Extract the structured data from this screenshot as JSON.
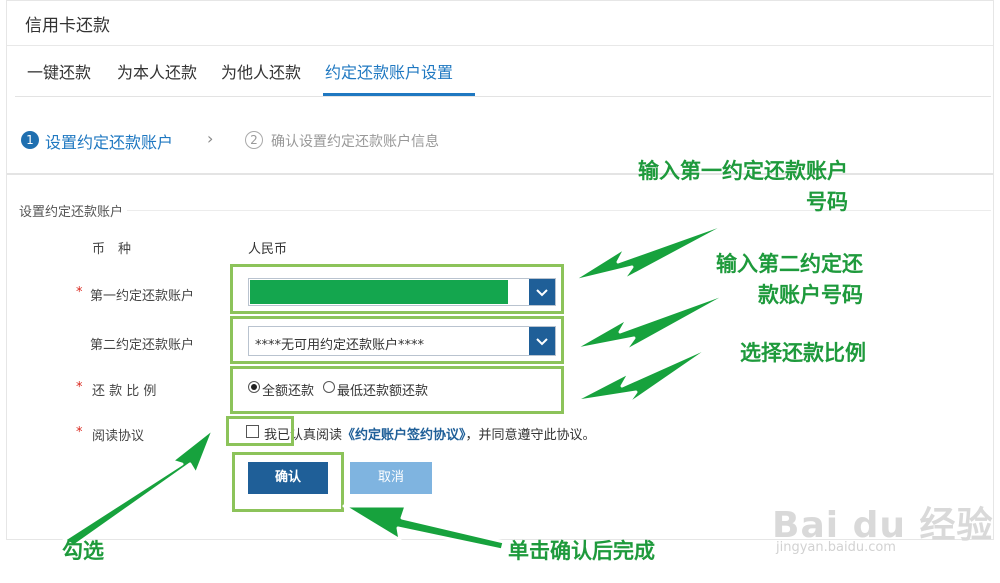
{
  "title": "信用卡还款",
  "tabs": [
    {
      "label": "一键还款"
    },
    {
      "label": "为本人还款"
    },
    {
      "label": "为他人还款"
    },
    {
      "label": "约定还款账户设置"
    }
  ],
  "steps": {
    "step1_num": "1",
    "step1_label": "设置约定还款账户",
    "chevron": "›",
    "step2_num": "2",
    "step2_label": "确认设置约定还款账户信息"
  },
  "section_title": "设置约定还款账户",
  "form": {
    "required_mark": "*",
    "currency_label": "币　种",
    "currency_value": "人民币",
    "account1_label": "第一约定还款账户",
    "account2_label": "第二约定还款账户",
    "account2_value": "****无可用约定还款账户****",
    "ratio_label": "还 款 比 例",
    "ratio_options": [
      {
        "label": "全额还款",
        "checked": true
      },
      {
        "label": "最低还款额还款",
        "checked": false
      }
    ],
    "agreement_label": "阅读协议",
    "agree_prefix": "我已认真阅读",
    "agree_link": "《约定账户签约协议》",
    "agree_suffix": "，并同意遵守此协议。",
    "dropdown_arrow": "⌄"
  },
  "buttons": {
    "confirm": "确认",
    "cancel": "取消"
  },
  "annotations": {
    "note1_line1": "输入第一约定还款账户",
    "note1_line2": "号码",
    "note2_line1": "输入第二约定还",
    "note2_line2": "款账户号码",
    "note3": "选择还款比例",
    "note4": "勾选",
    "note5": "单击确认后完成"
  },
  "colors": {
    "accent": "#1f78c1",
    "button_primary": "#1f5f98",
    "button_secondary": "#7fb4e0",
    "annotation_green": "#1e9a3c",
    "highlight_green": "#8cc35a",
    "masked_fill": "#14a64e"
  },
  "watermark": {
    "brand": "Bai du 经验",
    "url": "jingyan.baidu.com"
  }
}
